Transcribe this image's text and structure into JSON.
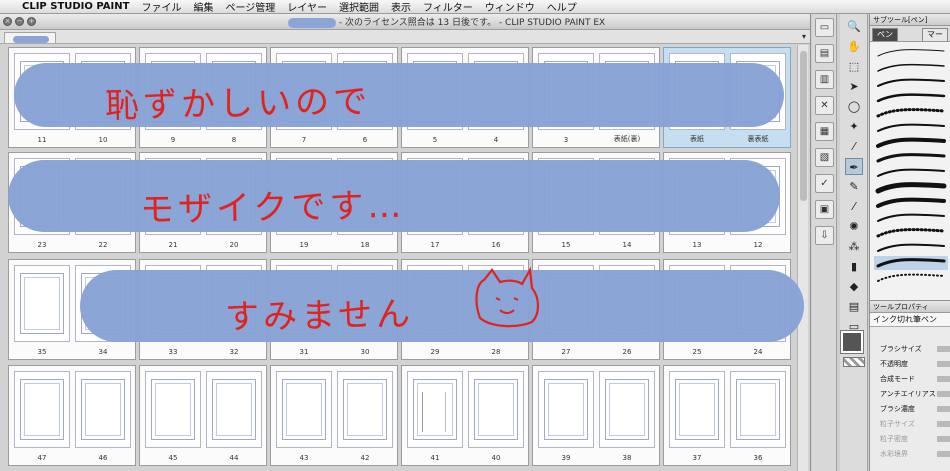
{
  "menubar": {
    "app": "CLIP STUDIO PAINT",
    "items": [
      "ファイル",
      "編集",
      "ページ管理",
      "レイヤー",
      "選択範囲",
      "表示",
      "フィルター",
      "ウィンドウ",
      "ヘルプ"
    ]
  },
  "window": {
    "title": "- 次のライセンス照合は 13 日後です。 - CLIP STUDIO PAINT EX"
  },
  "spreads": [
    [
      {
        "l": "11",
        "r": "10"
      },
      {
        "l": "9",
        "r": "8"
      },
      {
        "l": "7",
        "r": "6"
      },
      {
        "l": "5",
        "r": "4"
      },
      {
        "l": "3",
        "r": "表紙(裏)"
      },
      {
        "l": "表紙",
        "r": "裏表紙"
      }
    ],
    [
      {
        "l": "23",
        "r": "22"
      },
      {
        "l": "21",
        "r": "20"
      },
      {
        "l": "19",
        "r": "18"
      },
      {
        "l": "17",
        "r": "16"
      },
      {
        "l": "15",
        "r": "14"
      },
      {
        "l": "13",
        "r": "12"
      }
    ],
    [
      {
        "l": "35",
        "r": "34"
      },
      {
        "l": "33",
        "r": "32"
      },
      {
        "l": "31",
        "r": "30"
      },
      {
        "l": "29",
        "r": "28"
      },
      {
        "l": "27",
        "r": "26"
      },
      {
        "l": "25",
        "r": "24"
      }
    ],
    [
      {
        "l": "47",
        "r": "46"
      },
      {
        "l": "45",
        "r": "44"
      },
      {
        "l": "43",
        "r": "42"
      },
      {
        "l": "41",
        "r": "40"
      },
      {
        "l": "39",
        "r": "38"
      },
      {
        "l": "37",
        "r": "36"
      }
    ]
  ],
  "overlay": {
    "line1": "恥ずかしいので",
    "line2": "モザイクです…",
    "line3": "すみません"
  },
  "subtool": {
    "header": "サブツール[ペン]",
    "tab_pen": "ペン",
    "tab_marker": "マー"
  },
  "toolprop": {
    "header": "ツールプロパティ",
    "tool_name": "インク切れ筆ペン",
    "rows": [
      "ブラシサイズ",
      "不透明度",
      "合成モード",
      "アンチエイリアス",
      "ブラシ濃度",
      "粒子サイズ",
      "粒子密度",
      "水彩境界"
    ]
  },
  "colors": {
    "accent_blue": "#86a2d5",
    "handwriting_red": "#e0231e",
    "selected_spread": "#c6dff0"
  }
}
